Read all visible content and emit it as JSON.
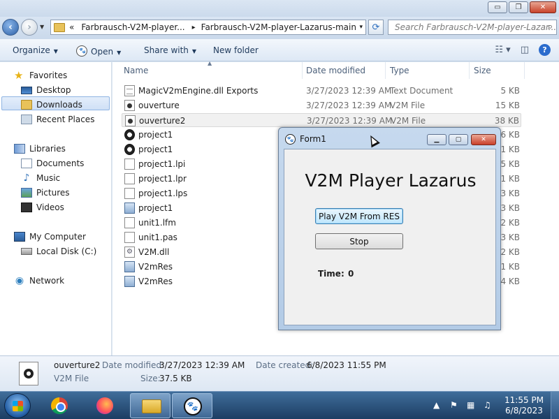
{
  "explorer": {
    "window_controls": {
      "minimize": "▭",
      "maximize": "❐",
      "close": "✕"
    },
    "address": {
      "prefix": "«",
      "crumbs": [
        "Farbrausch-V2M-player...",
        "Farbrausch-V2M-player-Lazarus-main"
      ],
      "separator": "▸",
      "dropdown": "▾"
    },
    "search": {
      "placeholder": "Search Farbrausch-V2M-player-Lazar..."
    },
    "toolbar": {
      "organize": "Organize",
      "open": "Open",
      "share_with": "Share with",
      "new_folder": "New folder",
      "help": "?"
    },
    "nav": {
      "favorites": "Favorites",
      "desktop": "Desktop",
      "downloads": "Downloads",
      "recent_places": "Recent Places",
      "libraries": "Libraries",
      "documents": "Documents",
      "music": "Music",
      "pictures": "Pictures",
      "videos": "Videos",
      "my_computer": "My Computer",
      "local_disk": "Local Disk (C:)",
      "network": "Network"
    },
    "columns": {
      "name": "Name",
      "date": "Date modified",
      "type": "Type",
      "size": "Size"
    },
    "files": [
      {
        "name": "MagicV2mEngine.dll Exports",
        "date": "3/27/2023 12:39 AM",
        "type": "Text Document",
        "size": "5 KB",
        "icon": "text-file-icon"
      },
      {
        "name": "ouverture",
        "date": "3/27/2023 12:39 AM",
        "type": "V2M File",
        "size": "15 KB",
        "icon": "v2m-file-icon"
      },
      {
        "name": "ouverture2",
        "date": "3/27/2023 12:39 AM",
        "type": "V2M File",
        "size": "38 KB",
        "icon": "v2m-file-icon"
      },
      {
        "name": "project1",
        "date": "",
        "type": "",
        "size": "16 KB",
        "icon": "paw-app-icon"
      },
      {
        "name": "project1",
        "date": "",
        "type": "",
        "size": "81 KB",
        "icon": "paw-app-icon"
      },
      {
        "name": "project1.lpi",
        "date": "",
        "type": "",
        "size": "5 KB",
        "icon": "blank-file-icon"
      },
      {
        "name": "project1.lpr",
        "date": "",
        "type": "",
        "size": "1 KB",
        "icon": "blank-file-icon"
      },
      {
        "name": "project1.lps",
        "date": "",
        "type": "",
        "size": "3 KB",
        "icon": "blank-file-icon"
      },
      {
        "name": "project1",
        "date": "",
        "type": "",
        "size": "83 KB",
        "icon": "exe-file-icon"
      },
      {
        "name": "unit1.lfm",
        "date": "",
        "type": "",
        "size": "2 KB",
        "icon": "blank-file-icon"
      },
      {
        "name": "unit1.pas",
        "date": "",
        "type": "",
        "size": "3 KB",
        "icon": "blank-file-icon"
      },
      {
        "name": "V2M.dll",
        "date": "",
        "type": "",
        "size": "22 KB",
        "icon": "dll-file-icon"
      },
      {
        "name": "V2mRes",
        "date": "",
        "type": "",
        "size": "1 KB",
        "icon": "exe-file-icon"
      },
      {
        "name": "V2mRes",
        "date": "",
        "type": "",
        "size": "74 KB",
        "icon": "exe-file-icon"
      }
    ],
    "details": {
      "name": "ouverture2",
      "type": "V2M File",
      "modified_label": "Date modified:",
      "modified_value": "3/27/2023 12:39 AM",
      "created_label": "Date created:",
      "created_value": "6/8/2023 11:55 PM",
      "size_label": "Size:",
      "size_value": "37.5 KB"
    }
  },
  "form1": {
    "title": "Form1",
    "heading": "V2M Player Lazarus",
    "play_button": "Play V2M From RES",
    "stop_button": "Stop",
    "time_label": "Time:",
    "time_value": "0",
    "controls": {
      "minimize": "▁",
      "maximize": "▢",
      "close": "✕"
    }
  },
  "taskbar": {
    "clock_time": "11:55 PM",
    "clock_date": "6/8/2023",
    "tray_arrow": "▲"
  }
}
